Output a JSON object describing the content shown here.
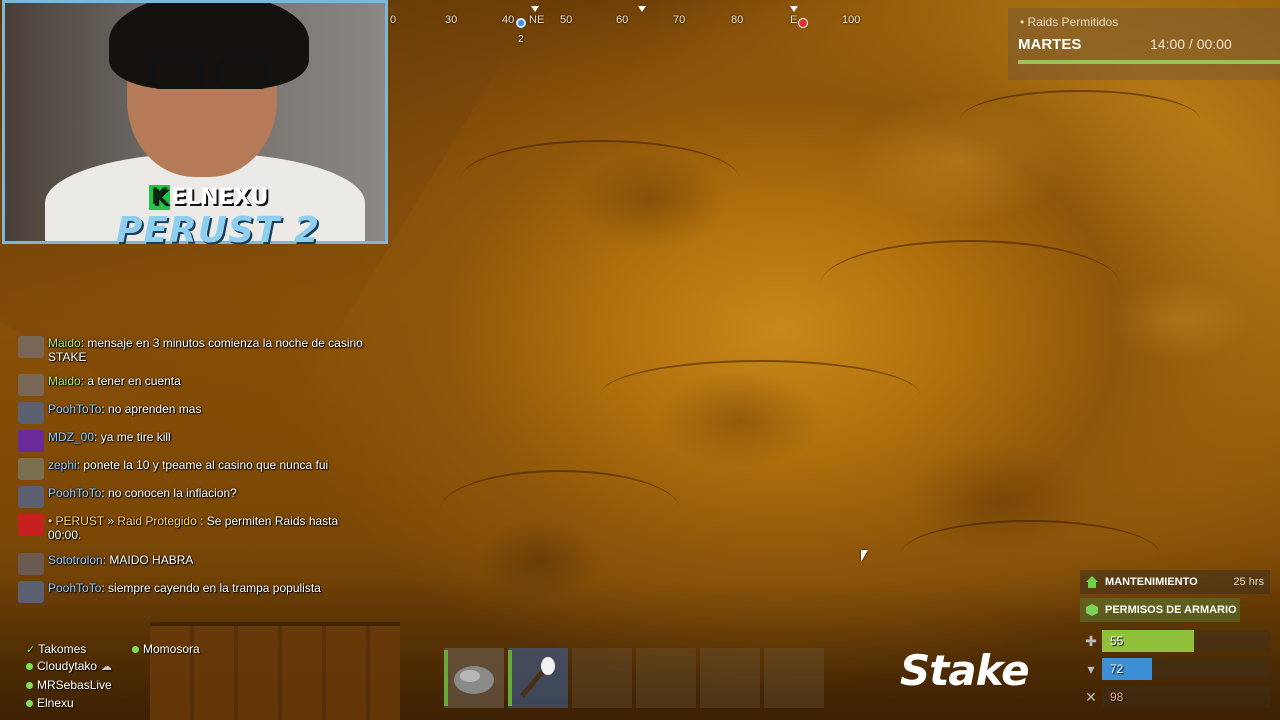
{
  "compass": {
    "ticks": [
      "30",
      "40",
      "NE",
      "50",
      "60",
      "70",
      "80",
      "E",
      "100"
    ],
    "pin_number": "2"
  },
  "overlay": {
    "brand_k": "K",
    "brand_name": "ELNEXU",
    "series": "PERUST 2"
  },
  "raids": {
    "title": "• Raids Permitidos",
    "day": "MARTES",
    "time": "14:00 / 00:00"
  },
  "chat": [
    {
      "user": "Maido",
      "message": "mensaje en 3 minutos comienza la noche de casino STAKE"
    },
    {
      "user": "Maido",
      "message": "a tener en cuenta"
    },
    {
      "user": "PoohToTo",
      "message": "no aprenden mas"
    },
    {
      "user": "MDZ_00",
      "message": "ya me tire kill"
    },
    {
      "user": "zephi",
      "message": "ponete la 10 y tpeame al casino que nunca fui"
    },
    {
      "user": "PoohToTo",
      "message": "no conocen la inflacion?"
    },
    {
      "prefix": "• PERUST",
      "sep": "»",
      "user": "Raid Protegido",
      "message": "Se permiten Raids hasta 00:00."
    },
    {
      "user": "Sototrolon",
      "message": "MAIDO HABRA"
    },
    {
      "user": "PoohToTo",
      "message": "siempre cayendo en la trampa populista"
    }
  ],
  "friends": [
    {
      "name": "Takomes",
      "status": "check"
    },
    {
      "name": "Cloudytako",
      "status": "sleeping"
    },
    {
      "name": "MRSebasLive",
      "status": "online"
    },
    {
      "name": "Elnexu",
      "status": "online"
    },
    {
      "name": "Momosora",
      "status": "online"
    }
  ],
  "hotbar": {
    "slots": [
      "rock",
      "torch",
      "",
      "",
      "",
      ""
    ]
  },
  "sponsor": "Stake",
  "base": {
    "upkeep_label": "MANTENIMIENTO",
    "upkeep_time": "25 hrs",
    "permissions_label": "PERMISOS DE ARMARIO"
  },
  "stats": {
    "health": {
      "value": "55",
      "fraction": 0.55,
      "color": "#8fc13a"
    },
    "thirst": {
      "value": "72",
      "fraction": 0.3,
      "color": "#3c8fd4"
    },
    "hunger": {
      "value": "98",
      "fraction": 0.0,
      "color": "#c86a2a"
    }
  }
}
